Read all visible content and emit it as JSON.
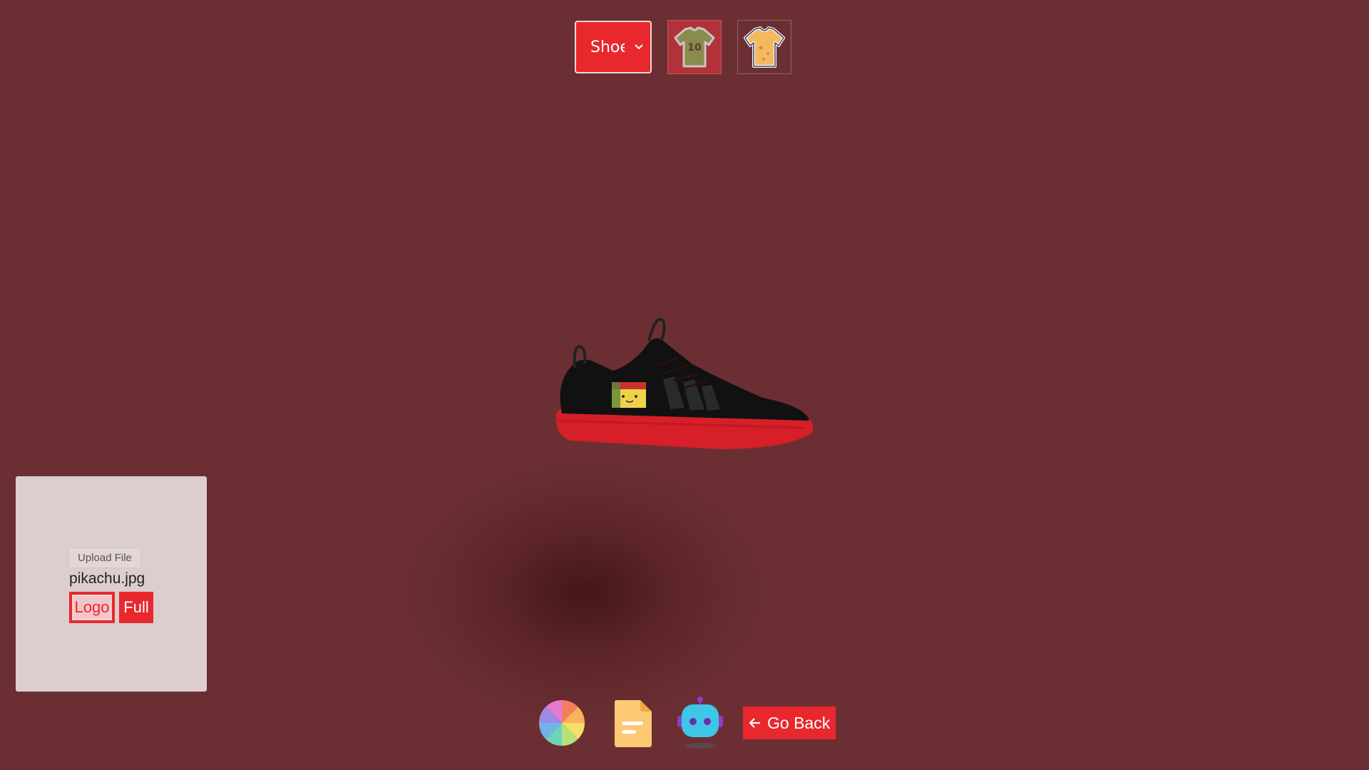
{
  "top_bar": {
    "model_select": {
      "value": "Shoe",
      "icon": "chevron-down-icon"
    },
    "tiles": [
      {
        "name": "jersey-10",
        "label": "10",
        "active": true
      },
      {
        "name": "tshirt",
        "active": false
      }
    ]
  },
  "upload_panel": {
    "upload_label": "Upload File",
    "file_name": "pikachu.jpg",
    "modes": {
      "logo": "Logo",
      "full": "Full"
    },
    "selected_mode": "Logo"
  },
  "bottom_bar": {
    "icons": [
      "color-wheel-icon",
      "file-icon",
      "robot-icon"
    ],
    "go_back_label": "Go Back",
    "go_back_icon": "arrow-left-icon"
  },
  "colors": {
    "background": "#6b2f33",
    "accent": "#e8282d",
    "panel": "#dccdce"
  }
}
